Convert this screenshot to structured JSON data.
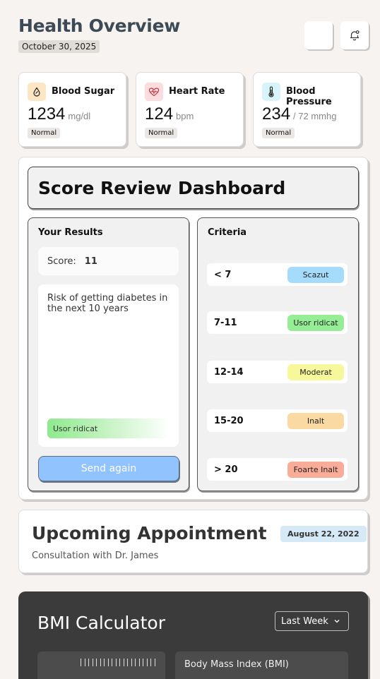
{
  "header": {
    "title": "Health Overview",
    "date": "October 30, 2025"
  },
  "vitals": [
    {
      "name": "Blood Sugar",
      "value": "1234",
      "unit": "mg/dl",
      "status": "Normal",
      "icon": "droplet-icon",
      "icon_bg": "#fde6c4"
    },
    {
      "name": "Heart Rate",
      "value": "124",
      "unit": "bpm",
      "status": "Normal",
      "icon": "heart-pulse-icon",
      "icon_bg": "#fcdcdc"
    },
    {
      "name": "Blood Pressure",
      "value": "234",
      "unit": "/ 72 mmhg",
      "status": "Normal",
      "icon": "thermometer-icon",
      "icon_bg": "#d7f4fa"
    }
  ],
  "score": {
    "title": "Score Review Dashboard",
    "results": {
      "heading": "Your Results",
      "score_label": "Score:",
      "score_value": "11",
      "risk_text": "Risk of getting diabetes in the next 10 years",
      "risk_level": "Usor ridicat",
      "send_label": "Send again"
    },
    "criteria": {
      "heading": "Criteria",
      "rows": [
        {
          "range": "< 7",
          "label": "Scazut",
          "color": "#a6dcfb"
        },
        {
          "range": "7-11",
          "label": "Usor ridicat",
          "color": "#95ed95"
        },
        {
          "range": "12-14",
          "label": "Moderat",
          "color": "#f7f79c"
        },
        {
          "range": "15-20",
          "label": "Inalt",
          "color": "#fbd9a2"
        },
        {
          "range": "> 20",
          "label": "Foarte Inalt",
          "color": "#f9ad98"
        }
      ]
    }
  },
  "appointment": {
    "title": "Upcoming Appointment",
    "date": "August 22, 2022",
    "subtitle": "Consultation with Dr. James"
  },
  "bmi": {
    "title": "BMI Calculator",
    "period": "Last Week",
    "box_label": "Body Mass Index (BMI)"
  }
}
